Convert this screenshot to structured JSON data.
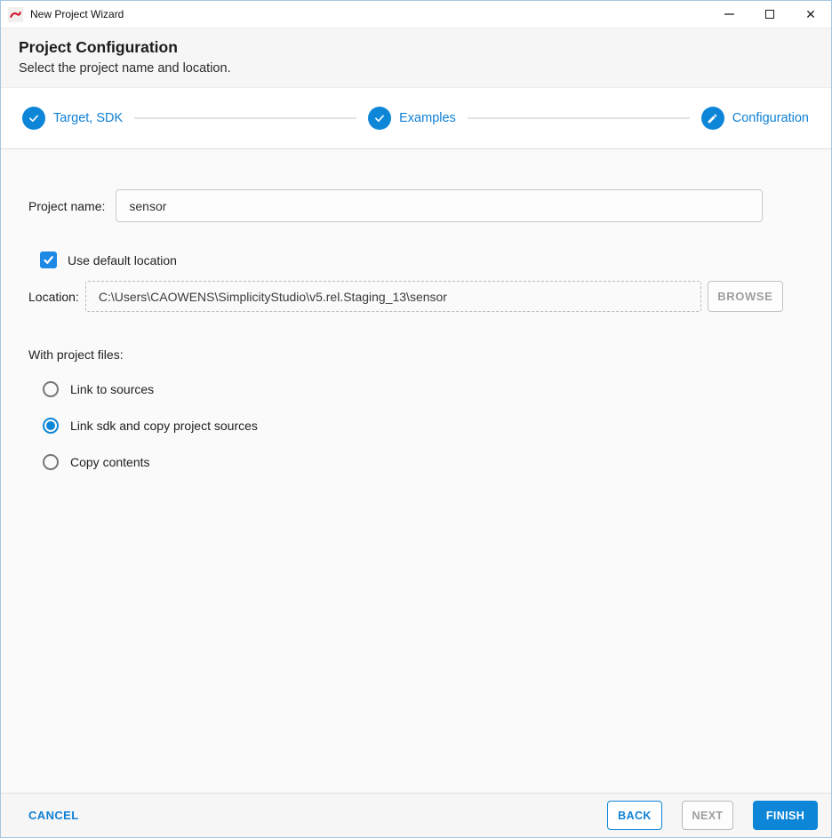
{
  "window": {
    "title": "New Project Wizard",
    "controls": {
      "minimize": "minimize",
      "maximize": "maximize",
      "close": "close"
    }
  },
  "header": {
    "title": "Project Configuration",
    "subtitle": "Select the project name and location."
  },
  "stepper": {
    "steps": [
      {
        "label": "Target, SDK",
        "state": "complete",
        "icon": "check-icon"
      },
      {
        "label": "Examples",
        "state": "complete",
        "icon": "check-icon"
      },
      {
        "label": "Configuration",
        "state": "current",
        "icon": "pencil-icon"
      }
    ]
  },
  "form": {
    "project_name": {
      "label": "Project name:",
      "value": "sensor"
    },
    "use_default_location": {
      "label": "Use default location",
      "checked": true
    },
    "location": {
      "label": "Location:",
      "value": "C:\\Users\\CAOWENS\\SimplicityStudio\\v5.rel.Staging_13\\sensor",
      "browse_label": "BROWSE",
      "browse_enabled": false
    },
    "with_project_files": {
      "label": "With project files:",
      "options": [
        {
          "label": "Link to sources",
          "selected": false
        },
        {
          "label": "Link sdk and copy project sources",
          "selected": true
        },
        {
          "label": "Copy contents",
          "selected": false
        }
      ]
    }
  },
  "footer": {
    "cancel_label": "CANCEL",
    "back_label": "BACK",
    "next_label": "NEXT",
    "finish_label": "FINISH"
  },
  "colors": {
    "accent": "#0d86d8",
    "accent_text": "#1080d4",
    "checkbox": "#1e88e5",
    "disabled": "#9e9e9e"
  }
}
